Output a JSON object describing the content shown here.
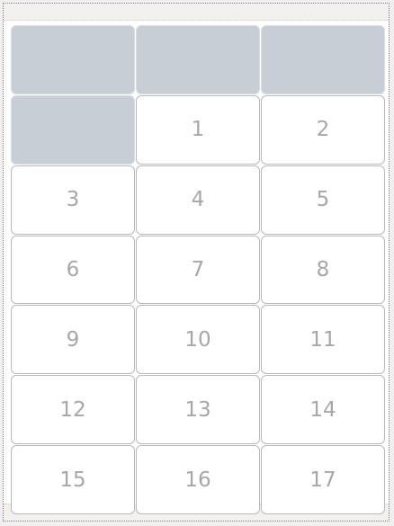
{
  "grid": {
    "leading_empty_cells": 4,
    "cells": [
      "1",
      "2",
      "3",
      "4",
      "5",
      "6",
      "7",
      "8",
      "9",
      "10",
      "11",
      "12",
      "13",
      "14",
      "15",
      "16",
      "17"
    ]
  },
  "colors": {
    "empty_cell": "#c8ced6",
    "cell_text": "#a7a7a7",
    "cell_border": "#b9b9b9"
  }
}
